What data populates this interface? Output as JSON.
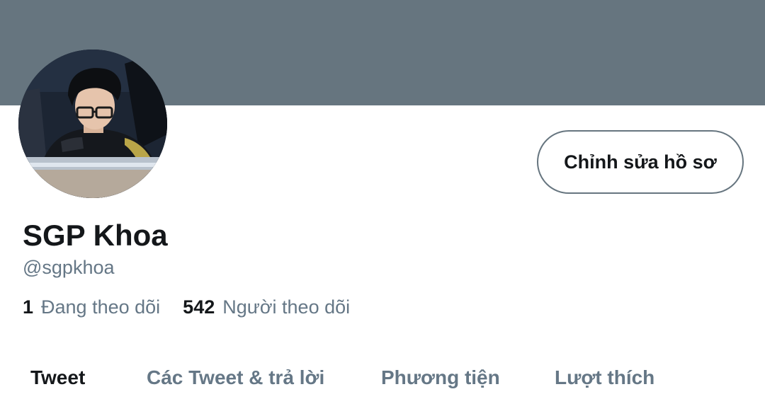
{
  "colors": {
    "banner": "#66757f",
    "primary_text": "#14171a",
    "secondary_text": "#657786",
    "button_border": "#66757f"
  },
  "profile": {
    "edit_button_label": "Chỉnh sửa hồ sơ",
    "display_name": "SGP Khoa",
    "handle": "@sgpkhoa",
    "avatar_icon": "profile-photo"
  },
  "stats": {
    "following_count": "1",
    "following_label": "Đang theo dõi",
    "followers_count": "542",
    "followers_label": "Người theo dõi"
  },
  "tabs": [
    {
      "label": "Tweet",
      "active": true
    },
    {
      "label": "Các Tweet & trả lời",
      "active": false
    },
    {
      "label": "Phương tiện",
      "active": false
    },
    {
      "label": "Lượt thích",
      "active": false
    }
  ]
}
